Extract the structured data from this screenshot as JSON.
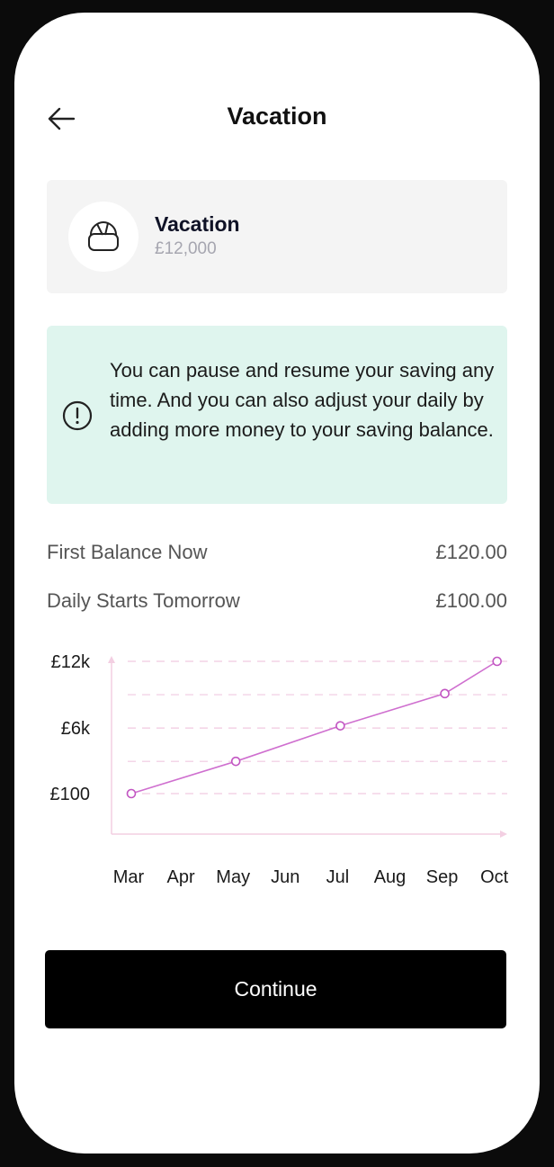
{
  "header": {
    "title": "Vacation",
    "back_icon": "arrow-left-icon"
  },
  "goal": {
    "name": "Vacation",
    "amount": "£12,000",
    "icon": "bag-icon"
  },
  "notice": {
    "icon": "alert-circle-icon",
    "text": "You can pause and resume your saving any time. And you can also adjust your daily by adding more money to your saving balance."
  },
  "summary": {
    "first_balance_label": "First Balance Now",
    "first_balance_value": "£120.00",
    "daily_label": "Daily Starts Tomorrow",
    "daily_value": "£100.00"
  },
  "chart_data": {
    "type": "line",
    "x": [
      "Mar",
      "Apr",
      "May",
      "Jun",
      "Jul",
      "Aug",
      "Sep",
      "Oct"
    ],
    "points": [
      {
        "x": "Mar",
        "y": 100
      },
      {
        "x": "May",
        "y": 3000
      },
      {
        "x": "Jul",
        "y": 6200
      },
      {
        "x": "Sep",
        "y": 9100
      },
      {
        "x": "Oct",
        "y": 12000
      }
    ],
    "y_ticks": [
      {
        "value": 100,
        "label": "£100"
      },
      {
        "value": 6000,
        "label": "£6k"
      },
      {
        "value": 12000,
        "label": "£12k"
      }
    ],
    "ylim": [
      100,
      12000
    ],
    "gridlines": [
      100,
      3000,
      6000,
      9000,
      12000
    ],
    "grid": true,
    "line_color": "#cf6fcf",
    "grid_color": "#f0c9e0",
    "axis_color": "#f3cfe2"
  },
  "actions": {
    "continue_label": "Continue"
  }
}
